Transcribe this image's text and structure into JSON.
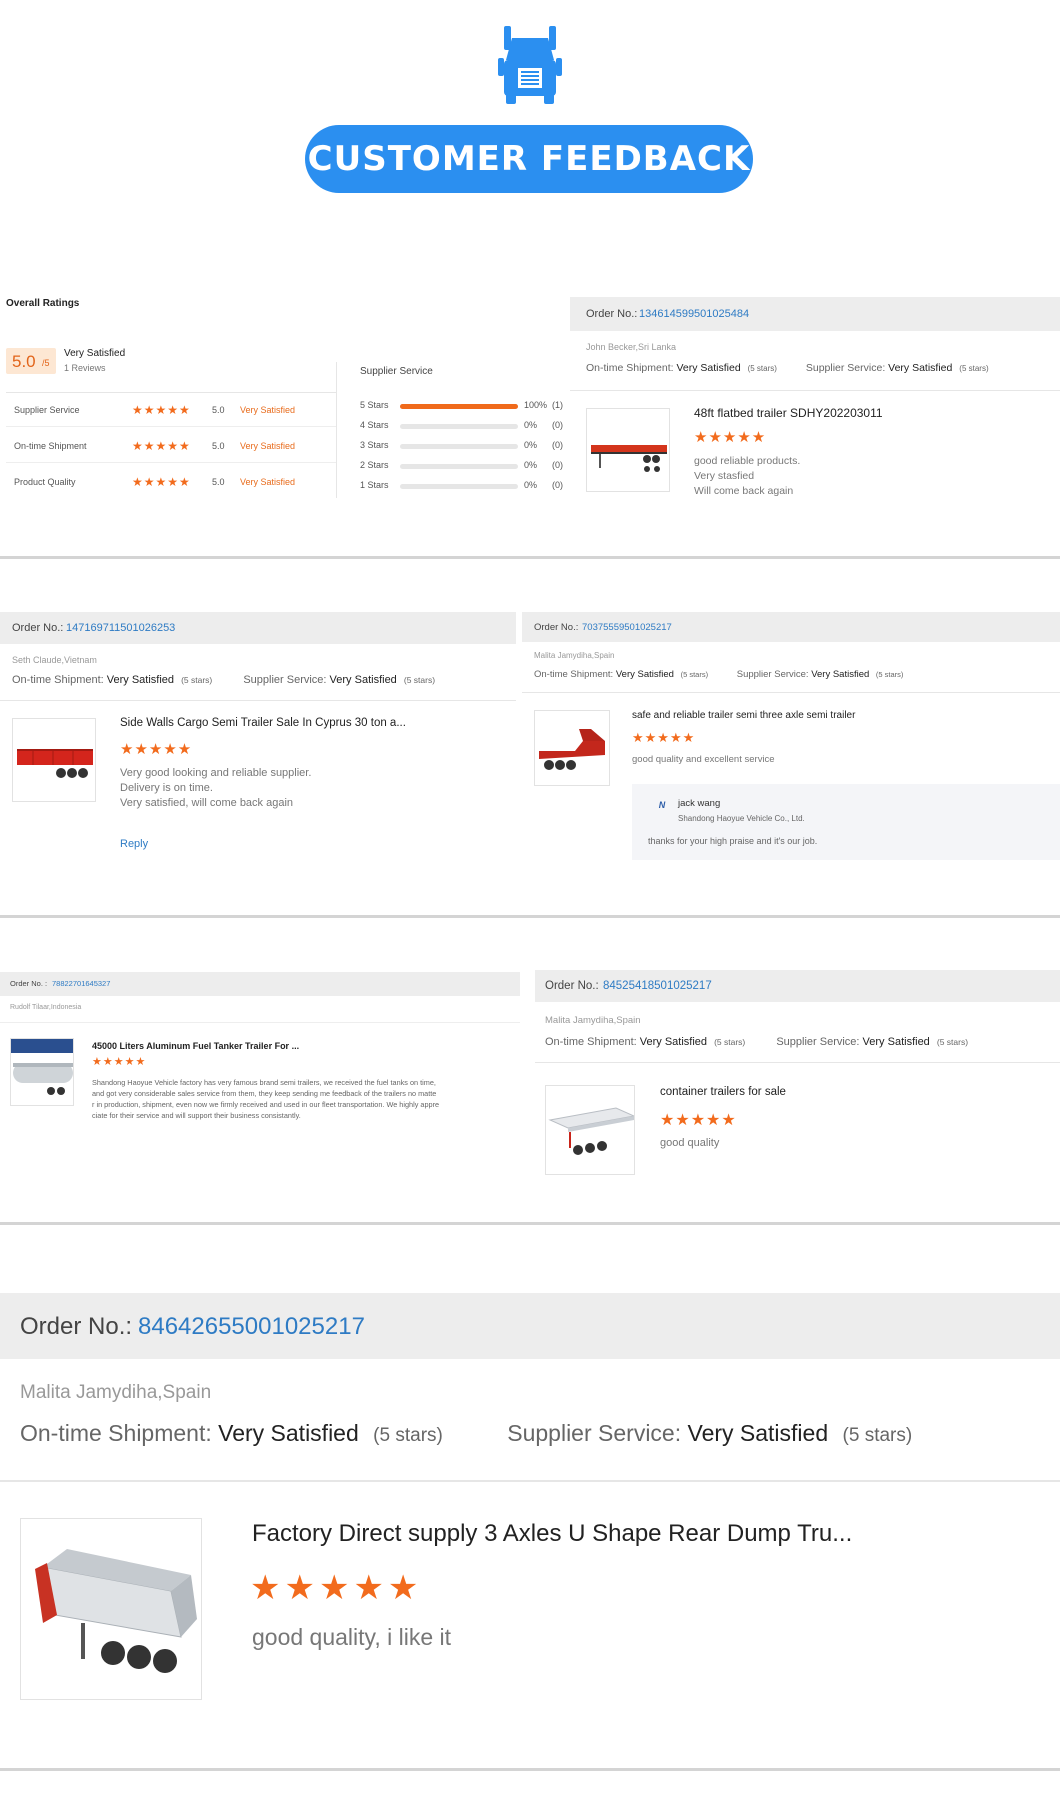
{
  "header": {
    "title": "CUSTOMER FEEDBACK",
    "icon": "truck-icon",
    "accent": "#2b8ff0"
  },
  "overall": {
    "title": "Overall Ratings",
    "score": "5.0",
    "score_suffix": "/5",
    "label": "Very Satisfied",
    "reviews": "1 Reviews",
    "rows": [
      {
        "name": "Supplier Service",
        "stars": "★★★★★",
        "score": "5.0",
        "label": "Very Satisfied"
      },
      {
        "name": "On-time Shipment",
        "stars": "★★★★★",
        "score": "5.0",
        "label": "Very Satisfied"
      },
      {
        "name": "Product Quality",
        "stars": "★★★★★",
        "score": "5.0",
        "label": "Very Satisfied"
      }
    ],
    "breakdown_title": "Supplier Service",
    "breakdown": [
      {
        "label": "5 Stars",
        "pct": "100%",
        "count": "(1)",
        "fill": 1.0
      },
      {
        "label": "4 Stars",
        "pct": "0%",
        "count": "(0)",
        "fill": 0
      },
      {
        "label": "3 Stars",
        "pct": "0%",
        "count": "(0)",
        "fill": 0
      },
      {
        "label": "2 Stars",
        "pct": "0%",
        "count": "(0)",
        "fill": 0
      },
      {
        "label": "1 Stars",
        "pct": "0%",
        "count": "(0)",
        "fill": 0
      }
    ]
  },
  "common": {
    "order_label": "Order No.:",
    "shipment_label": "On-time Shipment:",
    "service_label": "Supplier Service:",
    "very_satisfied": "Very Satisfied",
    "five_stars": "(5 stars)",
    "stars": "★★★★★",
    "order_label_spaced": "Order No. :"
  },
  "reviews": [
    {
      "order": "13461459950102548​4",
      "reviewer": "John Becker,Sri Lanka",
      "product": "48ft flatbed trailer SDHY202203011",
      "comment": [
        "good reliable products.",
        "Very stasfied",
        "Will come back again"
      ]
    },
    {
      "order": "147169711501026253",
      "reviewer": "Seth Claude,Vietnam",
      "product": "Side Walls Cargo Semi Trailer Sale In Cyprus 30 ton a...",
      "comment": [
        "Very good looking and reliable supplier.",
        "Delivery is on time.",
        "Very satisfied, will come back again"
      ],
      "reply": "Reply"
    },
    {
      "order": "70375559501025217",
      "reviewer": "Malita Jamydiha,Spain",
      "product": "safe and reliable trailer semi three axle semi trailer",
      "comment": [
        "good quality and excellent service"
      ],
      "supplier_reply": {
        "name": "jack wang",
        "company": "Shandong Haoyue Vehicle Co., Ltd.",
        "text": "thanks for your high praise and it's our job."
      }
    },
    {
      "order": "78822701645327",
      "reviewer": "Rudolf Tilaar,Indonesia",
      "product": "45000 Liters Aluminum Fuel Tanker Trailer For ...",
      "comment": [
        "Shandong Haoyue Vehicle factory has very famous brand semi trailers, we received the fuel tanks on time,",
        "and got very considerable sales service from them, they keep sending me feedback of the trailers no matte",
        "r in production, shipment, even now we firmly received and used in our fleet transportation. We highly appre",
        "ciate for their service and will support their business consistantly."
      ]
    },
    {
      "order": "84525418501025217",
      "reviewer": "Malita Jamydiha,Spain",
      "product": "container trailers for sale",
      "comment": [
        "good quality"
      ]
    },
    {
      "order": "84642655001025217",
      "reviewer": "Malita Jamydiha,Spain",
      "product": "Factory Direct supply 3 Axles U Shape Rear Dump Tru...",
      "comment": [
        "good quality, i like it"
      ]
    }
  ]
}
